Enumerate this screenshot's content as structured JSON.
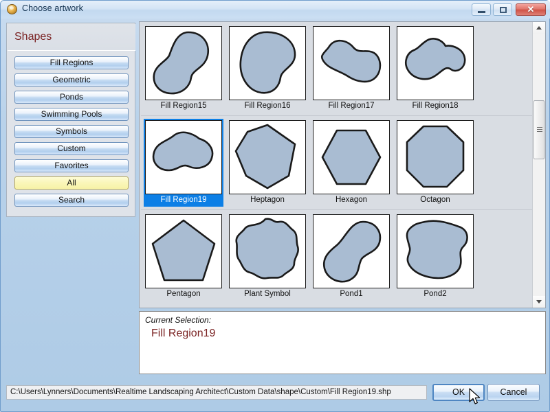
{
  "window": {
    "title": "Choose artwork",
    "icon": "palette-icon",
    "accent_selection": "#0c7fe6",
    "shape_fill": "#a9bcd2",
    "shape_stroke": "#1a1a1a",
    "heading_color": "#7a2222",
    "titlebar_buttons": {
      "minimize": "minimize-icon",
      "maximize": "maximize-icon",
      "close": "✕"
    }
  },
  "sidebar": {
    "title": "Shapes",
    "items": [
      {
        "label": "Fill Regions",
        "selected": false
      },
      {
        "label": "Geometric",
        "selected": false
      },
      {
        "label": "Ponds",
        "selected": false
      },
      {
        "label": "Swimming Pools",
        "selected": false
      },
      {
        "label": "Symbols",
        "selected": false
      },
      {
        "label": "Custom",
        "selected": false
      },
      {
        "label": "Favorites",
        "selected": false
      },
      {
        "label": "All",
        "selected": true
      },
      {
        "label": "Search",
        "selected": false
      }
    ]
  },
  "gallery": {
    "columns": 4,
    "items": [
      {
        "label": "Fill Region15",
        "shape": "blob-kidney",
        "selected": false
      },
      {
        "label": "Fill Region16",
        "shape": "blob-round",
        "selected": false
      },
      {
        "label": "Fill Region17",
        "shape": "blob-gourd",
        "selected": false
      },
      {
        "label": "Fill Region18",
        "shape": "blob-wave",
        "selected": false
      },
      {
        "label": "Fill Region19",
        "shape": "blob-lumpy",
        "selected": true
      },
      {
        "label": "Heptagon",
        "shape": "heptagon",
        "selected": false
      },
      {
        "label": "Hexagon",
        "shape": "hexagon",
        "selected": false
      },
      {
        "label": "Octagon",
        "shape": "octagon",
        "selected": false
      },
      {
        "label": "Pentagon",
        "shape": "pentagon",
        "selected": false
      },
      {
        "label": "Plant Symbol",
        "shape": "plant-symbol",
        "selected": false
      },
      {
        "label": "Pond1",
        "shape": "pond1",
        "selected": false
      },
      {
        "label": "Pond2",
        "shape": "pond2",
        "selected": false
      }
    ]
  },
  "scrollbar": {
    "up_arrow": "scroll-up-icon",
    "down_arrow": "scroll-down-icon",
    "thumb_position_pct": 28
  },
  "selection": {
    "caption": "Current Selection:",
    "value": "Fill Region19"
  },
  "path_bar": {
    "value": "C:\\Users\\Lynners\\Documents\\Realtime Landscaping Architect\\Custom Data\\shape\\Custom\\Fill Region19.shp"
  },
  "buttons": {
    "ok": "OK",
    "cancel": "Cancel"
  }
}
